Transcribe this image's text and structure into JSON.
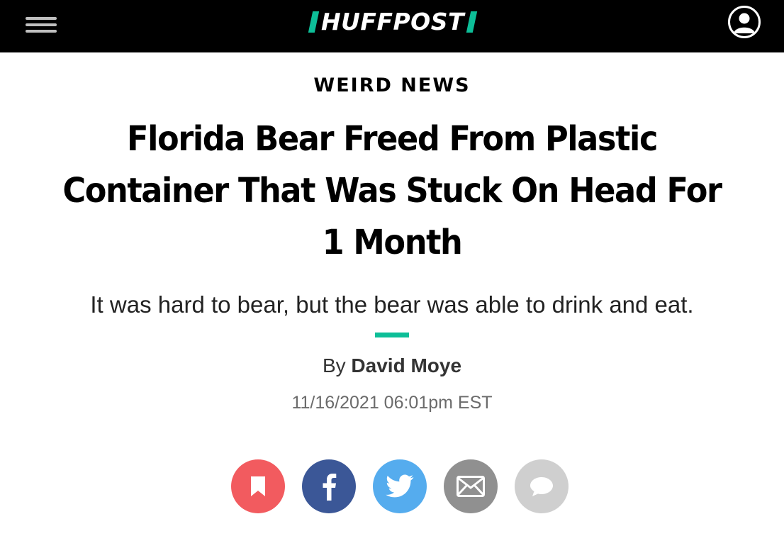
{
  "header": {
    "logo_text": "HUFFPOST",
    "accent_color": "#0dbe98",
    "background_color": "#000000",
    "menu_icon": "hamburger-menu-icon",
    "account_icon": "user-account-icon"
  },
  "article": {
    "section": "WEIRD NEWS",
    "headline_line1": "Florida Bear Freed From Plastic",
    "headline_line2": "Container That Was Stuck On Head For",
    "headline_line3": "1 Month",
    "subheadline": "It was hard to bear, but the bear was able to drink and eat.",
    "byline_prefix": "By",
    "author": "David Moye",
    "timestamp": "11/16/2021 06:01pm EST"
  },
  "share": {
    "buttons": [
      {
        "icon": "bookmark-icon",
        "color": "#f25b5f"
      },
      {
        "icon": "facebook-icon",
        "color": "#3b5797"
      },
      {
        "icon": "twitter-icon",
        "color": "#55acee"
      },
      {
        "icon": "email-icon",
        "color": "#909090"
      },
      {
        "icon": "comment-icon",
        "color": "#cfcfcf"
      }
    ]
  }
}
